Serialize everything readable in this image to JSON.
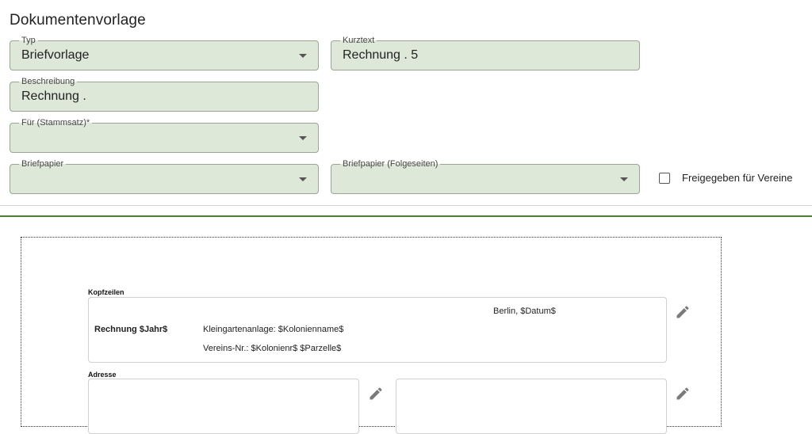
{
  "page": {
    "title": "Dokumentenvorlage"
  },
  "form": {
    "typ": {
      "label": "Typ",
      "value": "Briefvorlage"
    },
    "kurztext": {
      "label": "Kurztext",
      "value": "Rechnung .   5"
    },
    "beschreibung": {
      "label": "Beschreibung",
      "value": "Rechnung ."
    },
    "fuer": {
      "label": "Für (Stammsatz)*",
      "value": ""
    },
    "briefpapier": {
      "label": "Briefpapier",
      "value": ""
    },
    "briefpapier_folge": {
      "label": "Briefpapier (Folgeseiten)",
      "value": ""
    },
    "freigegeben": {
      "label": "Freigegeben für Vereine",
      "checked": false
    }
  },
  "template": {
    "kopfzeilen": {
      "label": "Kopfzeilen",
      "datum": "Berlin, $Datum$",
      "title": "Rechnung $Jahr$",
      "line1": "Kleingartenanlage: $Kolonienname$",
      "line2": "Vereins-Nr.: $Kolonienr$ $Parzelle$"
    },
    "adresse": {
      "label": "Adresse"
    }
  },
  "icons": {
    "edit": "pencil-icon",
    "dropdown": "caret-down-icon"
  },
  "colors": {
    "field_bg": "#dde8d8",
    "accent_green": "#4e7a34"
  }
}
